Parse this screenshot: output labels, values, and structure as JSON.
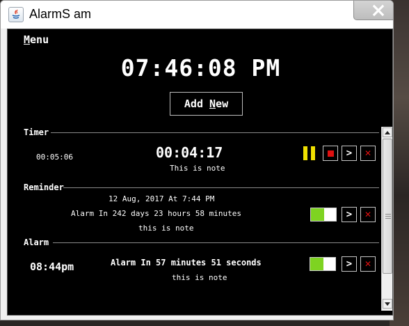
{
  "window": {
    "title": "AlarmS am"
  },
  "menu": {
    "label_first": "M",
    "label_rest": "enu"
  },
  "clock": {
    "current_time": "07:46:08 PM"
  },
  "add_button": {
    "label_pre": "Add ",
    "label_u": "N",
    "label_post": "ew"
  },
  "timer": {
    "section_title": "Timer",
    "elapsed": "00:05:06",
    "remaining": "00:04:17",
    "note": "This is note"
  },
  "reminder": {
    "section_title": "Reminder",
    "datetime": "12 Aug, 2017 At 7:44 PM",
    "countdown": "Alarm In 242 days 23 hours 58 minutes",
    "note": "this is note",
    "enabled": true
  },
  "alarm": {
    "section_title": "Alarm",
    "time": "08:44pm",
    "countdown": "Alarm In 57 minutes 51 seconds",
    "note": "this is note",
    "enabled": true
  },
  "controls": {
    "next_symbol": ">",
    "delete_symbol": "✕"
  },
  "colors": {
    "background": "#000000",
    "pause": "#f0e000",
    "stop": "#e01010",
    "delete": "#e01010",
    "toggle_on": "#7ed321"
  }
}
